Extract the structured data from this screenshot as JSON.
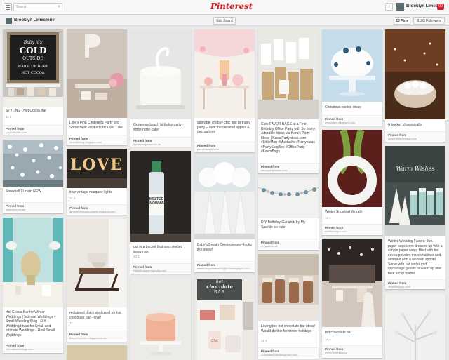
{
  "topbar": {
    "search_placeholder": "Search",
    "logo": "Pinterest",
    "user_name": "Brooklyn Limes...",
    "notification_count": "99"
  },
  "board": {
    "name": "Brooklyn Limestone",
    "edit_label": "Edit Board",
    "pins_tab": "23 Pins",
    "followers_tab": "9103 Followers"
  },
  "pinned_from": "Pinned from",
  "pins": [
    {
      "desc": "STYLiNG | Hot Cocoa Bar",
      "stats": "11  6",
      "source": "paylinesales.com"
    },
    {
      "desc": "Lillie's Pink Cinderella Party and Some New Products by Dear Lillie",
      "stats": "",
      "source": "dearlilliebog.blogspot.com"
    },
    {
      "desc": "Gorgeous beach birthday party - white ruffle cake",
      "stats": "",
      "source": "kardisnunjahuet.co.uk"
    },
    {
      "desc": "adorable shabby chic first birthday party -- love the caramel apples & decorations",
      "stats": "",
      "source": "jennysaviour.com"
    },
    {
      "desc": "Cute FAVOR BAGS at a First Birthday Office Party with So Many Adorable Ideas via Kara's Party Ideas | KarasPartyIdeas.com #LittleMan #Mustache #PartyIdeas #PartySupplies #OfficeParty #FavorBags",
      "stats": "",
      "source": "karaspartyideas.com"
    },
    {
      "desc": "Christmas cookie ideas",
      "stats": "",
      "source": "artsandinc.blogspot.com"
    },
    {
      "desc": "A bucket of snowballs",
      "stats": "",
      "source": "svlgardinfacebase.com"
    },
    {
      "desc": "Snowball Curtain NEW",
      "stats": "",
      "source": "sasadeco.ee.ee"
    },
    {
      "desc": "love vintage marquee lights",
      "stats": "11  2",
      "source": "arborvineweddingsfalls.blogspot.com"
    },
    {
      "desc": "put in a bucket that says melted snowman.",
      "stats": "13  1",
      "source": "littlebithappymagically.com"
    },
    {
      "desc": "Baby's Breath Centerpieces - looks like snow!",
      "stats": "",
      "source": "mermaidpinesweddingbridesblogspot.com"
    },
    {
      "desc": "DIY Birthday Garland, by My Sparkle so cute!",
      "stats": "",
      "source": "mysparkle.ca"
    },
    {
      "desc": "Winter Snowball Wreath",
      "stats": "12  1",
      "source": "shellidesigns.com"
    },
    {
      "desc": "Winter Wedding Favors: 8oz. paper cups were dressed up with a simple paper wrap, filled with hot cocoa powder, marshmallows and adorned with a wooden spoon! Serve with hot water and encourage guests to warm up and take a cup home!",
      "stats": "",
      "source": "largeshitinsic.com"
    },
    {
      "desc": "Hot Cocoa Bar for Winter Weddings | Intimate Weddings - Small Wedding Blog - DIY Wedding Ideas for Small and Intimate Weddings - Real Small Weddings",
      "stats": "11  2",
      "source": "intimateweddings.com"
    },
    {
      "desc": "reclaimed dutch sled used for hot chocolate bar - love!",
      "stats": "11",
      "source": "theprettybetter.blogspot.co.uk"
    },
    {
      "desc": "Loving the hot chocolate bar ideas! Would do this for winter holidays",
      "stats": "11  1",
      "source": "1ownbeachweddingbuzz.com"
    },
    {
      "desc": "hot chocolate bar",
      "stats": "12  1",
      "source": "stylemepretty.com"
    }
  ],
  "sign": {
    "line1": "Baby it's",
    "line2": "COLD",
    "line3": "OUTSIDE",
    "line4": "WARM UP HERE",
    "line5": "HOT COCOA"
  },
  "chocolate_sign": {
    "line1": "hot",
    "line2": "chocolate",
    "line3": "BAR"
  },
  "marquee": "LOVE",
  "bottle_label": "MELTED SNOWMAN",
  "favor_sign": "Warm Wishes",
  "cup_label": "Chic",
  "colors": {
    "brand_red": "#cb2027",
    "background": "#e9e9e9"
  }
}
